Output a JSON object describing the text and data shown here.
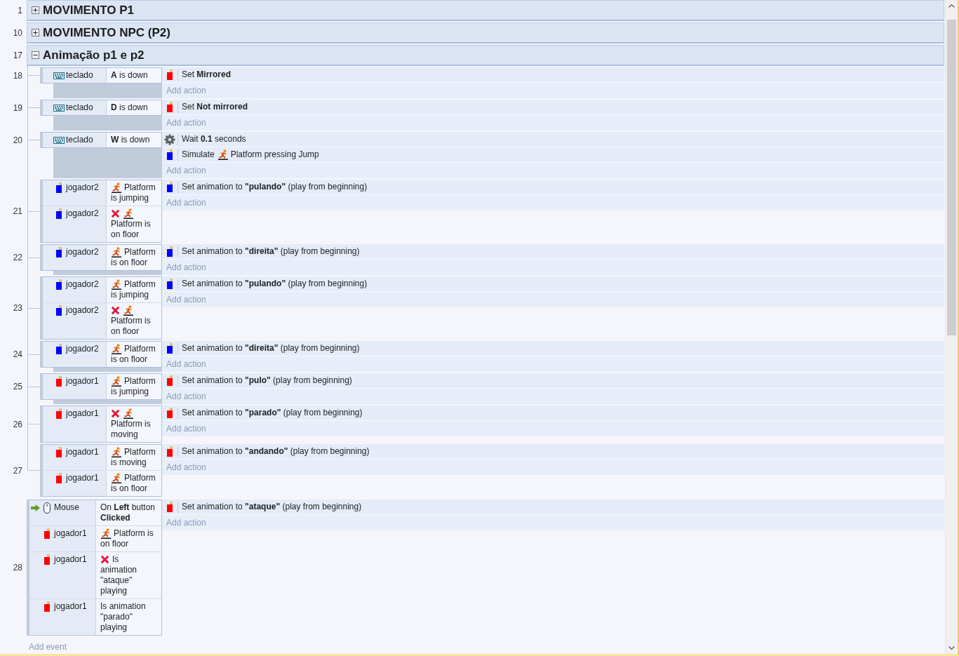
{
  "event_sheet": {
    "items": [
      {
        "kind": "group",
        "line": "1",
        "title": "MOVIMENTO P1",
        "expanded": false
      },
      {
        "kind": "group",
        "line": "10",
        "title": "MOVIMENTO NPC (P2)",
        "expanded": false
      },
      {
        "kind": "group",
        "line": "17",
        "title": "Animação p1 e p2",
        "expanded": true,
        "events": [
          {
            "line": "18",
            "conditions": [
              {
                "kind": "keyboard",
                "object": "teclado",
                "trigger": false,
                "inverted": false,
                "behavior_icon": false,
                "text": "**A** is down"
              }
            ],
            "actions": [
              {
                "kind": "sprite",
                "color": "#ff0000",
                "behavior_icon": false,
                "text": "Set **Mirrored**"
              }
            ],
            "add_action": "Add action"
          },
          {
            "line": "19",
            "conditions": [
              {
                "kind": "keyboard",
                "object": "teclado",
                "trigger": false,
                "inverted": false,
                "behavior_icon": false,
                "text": "**D** is down"
              }
            ],
            "actions": [
              {
                "kind": "sprite",
                "color": "#ff0000",
                "behavior_icon": false,
                "text": "Set **Not mirrored**"
              }
            ],
            "add_action": "Add action"
          },
          {
            "line": "20",
            "conditions": [
              {
                "kind": "keyboard",
                "object": "teclado",
                "trigger": false,
                "inverted": false,
                "behavior_icon": false,
                "text": "**W** is down"
              }
            ],
            "actions": [
              {
                "kind": "system",
                "behavior_icon": false,
                "text": "Wait **0.1** seconds"
              },
              {
                "kind": "sprite",
                "color": "#0000ff",
                "prefix": "Simulate",
                "behavior_icon": true,
                "text": "Platform pressing Jump"
              }
            ],
            "add_action": "Add action"
          },
          {
            "line": "21",
            "conditions": [
              {
                "kind": "sprite",
                "color": "#0000ff",
                "object": "jogador2",
                "trigger": false,
                "inverted": false,
                "behavior_icon": true,
                "text": "Platform is jumping"
              },
              {
                "kind": "sprite",
                "color": "#0000ff",
                "object": "jogador2",
                "trigger": false,
                "inverted": true,
                "behavior_icon": true,
                "text": "Platform is on floor"
              }
            ],
            "actions": [
              {
                "kind": "sprite",
                "color": "#0000ff",
                "behavior_icon": false,
                "text": "Set animation to **\"pulando\"** (play from beginning)"
              }
            ],
            "add_action": "Add action"
          },
          {
            "line": "22",
            "conditions": [
              {
                "kind": "sprite",
                "color": "#0000ff",
                "object": "jogador2",
                "trigger": false,
                "inverted": false,
                "behavior_icon": true,
                "text": "Platform is on floor"
              }
            ],
            "actions": [
              {
                "kind": "sprite",
                "color": "#0000ff",
                "behavior_icon": false,
                "text": "Set animation to **\"direita\"** (play from beginning)"
              }
            ],
            "add_action": "Add action"
          },
          {
            "line": "23",
            "conditions": [
              {
                "kind": "sprite",
                "color": "#0000ff",
                "object": "jogador2",
                "trigger": false,
                "inverted": false,
                "behavior_icon": true,
                "text": "Platform is jumping"
              },
              {
                "kind": "sprite",
                "color": "#0000ff",
                "object": "jogador2",
                "trigger": false,
                "inverted": true,
                "behavior_icon": true,
                "text": "Platform is on floor"
              }
            ],
            "actions": [
              {
                "kind": "sprite",
                "color": "#0000ff",
                "behavior_icon": false,
                "text": "Set animation to **\"pulando\"** (play from beginning)"
              }
            ],
            "add_action": "Add action"
          },
          {
            "line": "24",
            "conditions": [
              {
                "kind": "sprite",
                "color": "#0000ff",
                "object": "jogador2",
                "trigger": false,
                "inverted": false,
                "behavior_icon": true,
                "text": "Platform is on floor"
              }
            ],
            "actions": [
              {
                "kind": "sprite",
                "color": "#0000ff",
                "behavior_icon": false,
                "text": "Set animation to **\"direita\"** (play from beginning)"
              }
            ],
            "add_action": "Add action"
          },
          {
            "line": "25",
            "conditions": [
              {
                "kind": "sprite",
                "color": "#ff0000",
                "object": "jogador1",
                "trigger": false,
                "inverted": false,
                "behavior_icon": true,
                "text": "Platform is jumping"
              }
            ],
            "actions": [
              {
                "kind": "sprite",
                "color": "#ff0000",
                "behavior_icon": false,
                "text": "Set animation to **\"pulo\"** (play from beginning)"
              }
            ],
            "add_action": "Add action"
          },
          {
            "line": "26",
            "conditions": [
              {
                "kind": "sprite",
                "color": "#ff0000",
                "object": "jogador1",
                "trigger": false,
                "inverted": true,
                "behavior_icon": true,
                "text": "Platform is moving"
              }
            ],
            "actions": [
              {
                "kind": "sprite",
                "color": "#ff0000",
                "behavior_icon": false,
                "text": "Set animation to **\"parado\"** (play from beginning)"
              }
            ],
            "add_action": "Add action"
          },
          {
            "line": "27",
            "conditions": [
              {
                "kind": "sprite",
                "color": "#ff0000",
                "object": "jogador1",
                "trigger": false,
                "inverted": false,
                "behavior_icon": true,
                "text": "Platform is moving"
              },
              {
                "kind": "sprite",
                "color": "#ff0000",
                "object": "jogador1",
                "trigger": false,
                "inverted": false,
                "behavior_icon": true,
                "text": "Platform is on floor"
              }
            ],
            "actions": [
              {
                "kind": "sprite",
                "color": "#ff0000",
                "behavior_icon": false,
                "text": "Set animation to **\"andando\"** (play from beginning)"
              }
            ],
            "add_action": "Add action"
          }
        ]
      },
      {
        "kind": "event",
        "line": "28",
        "conditions": [
          {
            "kind": "mouse",
            "object": "Mouse",
            "trigger": true,
            "inverted": false,
            "behavior_icon": false,
            "text": "On **Left** button **Clicked**"
          },
          {
            "kind": "sprite",
            "color": "#ff0000",
            "object": "jogador1",
            "trigger": false,
            "inverted": false,
            "behavior_icon": true,
            "text": "Platform is on floor"
          },
          {
            "kind": "sprite",
            "color": "#ff0000",
            "object": "jogador1",
            "trigger": false,
            "inverted": true,
            "behavior_icon": false,
            "text": "Is animation \"ataque\" playing"
          },
          {
            "kind": "sprite",
            "color": "#ff0000",
            "object": "jogador1",
            "trigger": false,
            "inverted": false,
            "behavior_icon": false,
            "text": "Is animation \"parado\" playing"
          }
        ],
        "actions": [
          {
            "kind": "sprite",
            "color": "#ff0000",
            "behavior_icon": false,
            "text": "Set animation to **\"ataque\"** (play from beginning)"
          }
        ],
        "add_action": "Add action"
      }
    ],
    "add_event": "Add event"
  }
}
